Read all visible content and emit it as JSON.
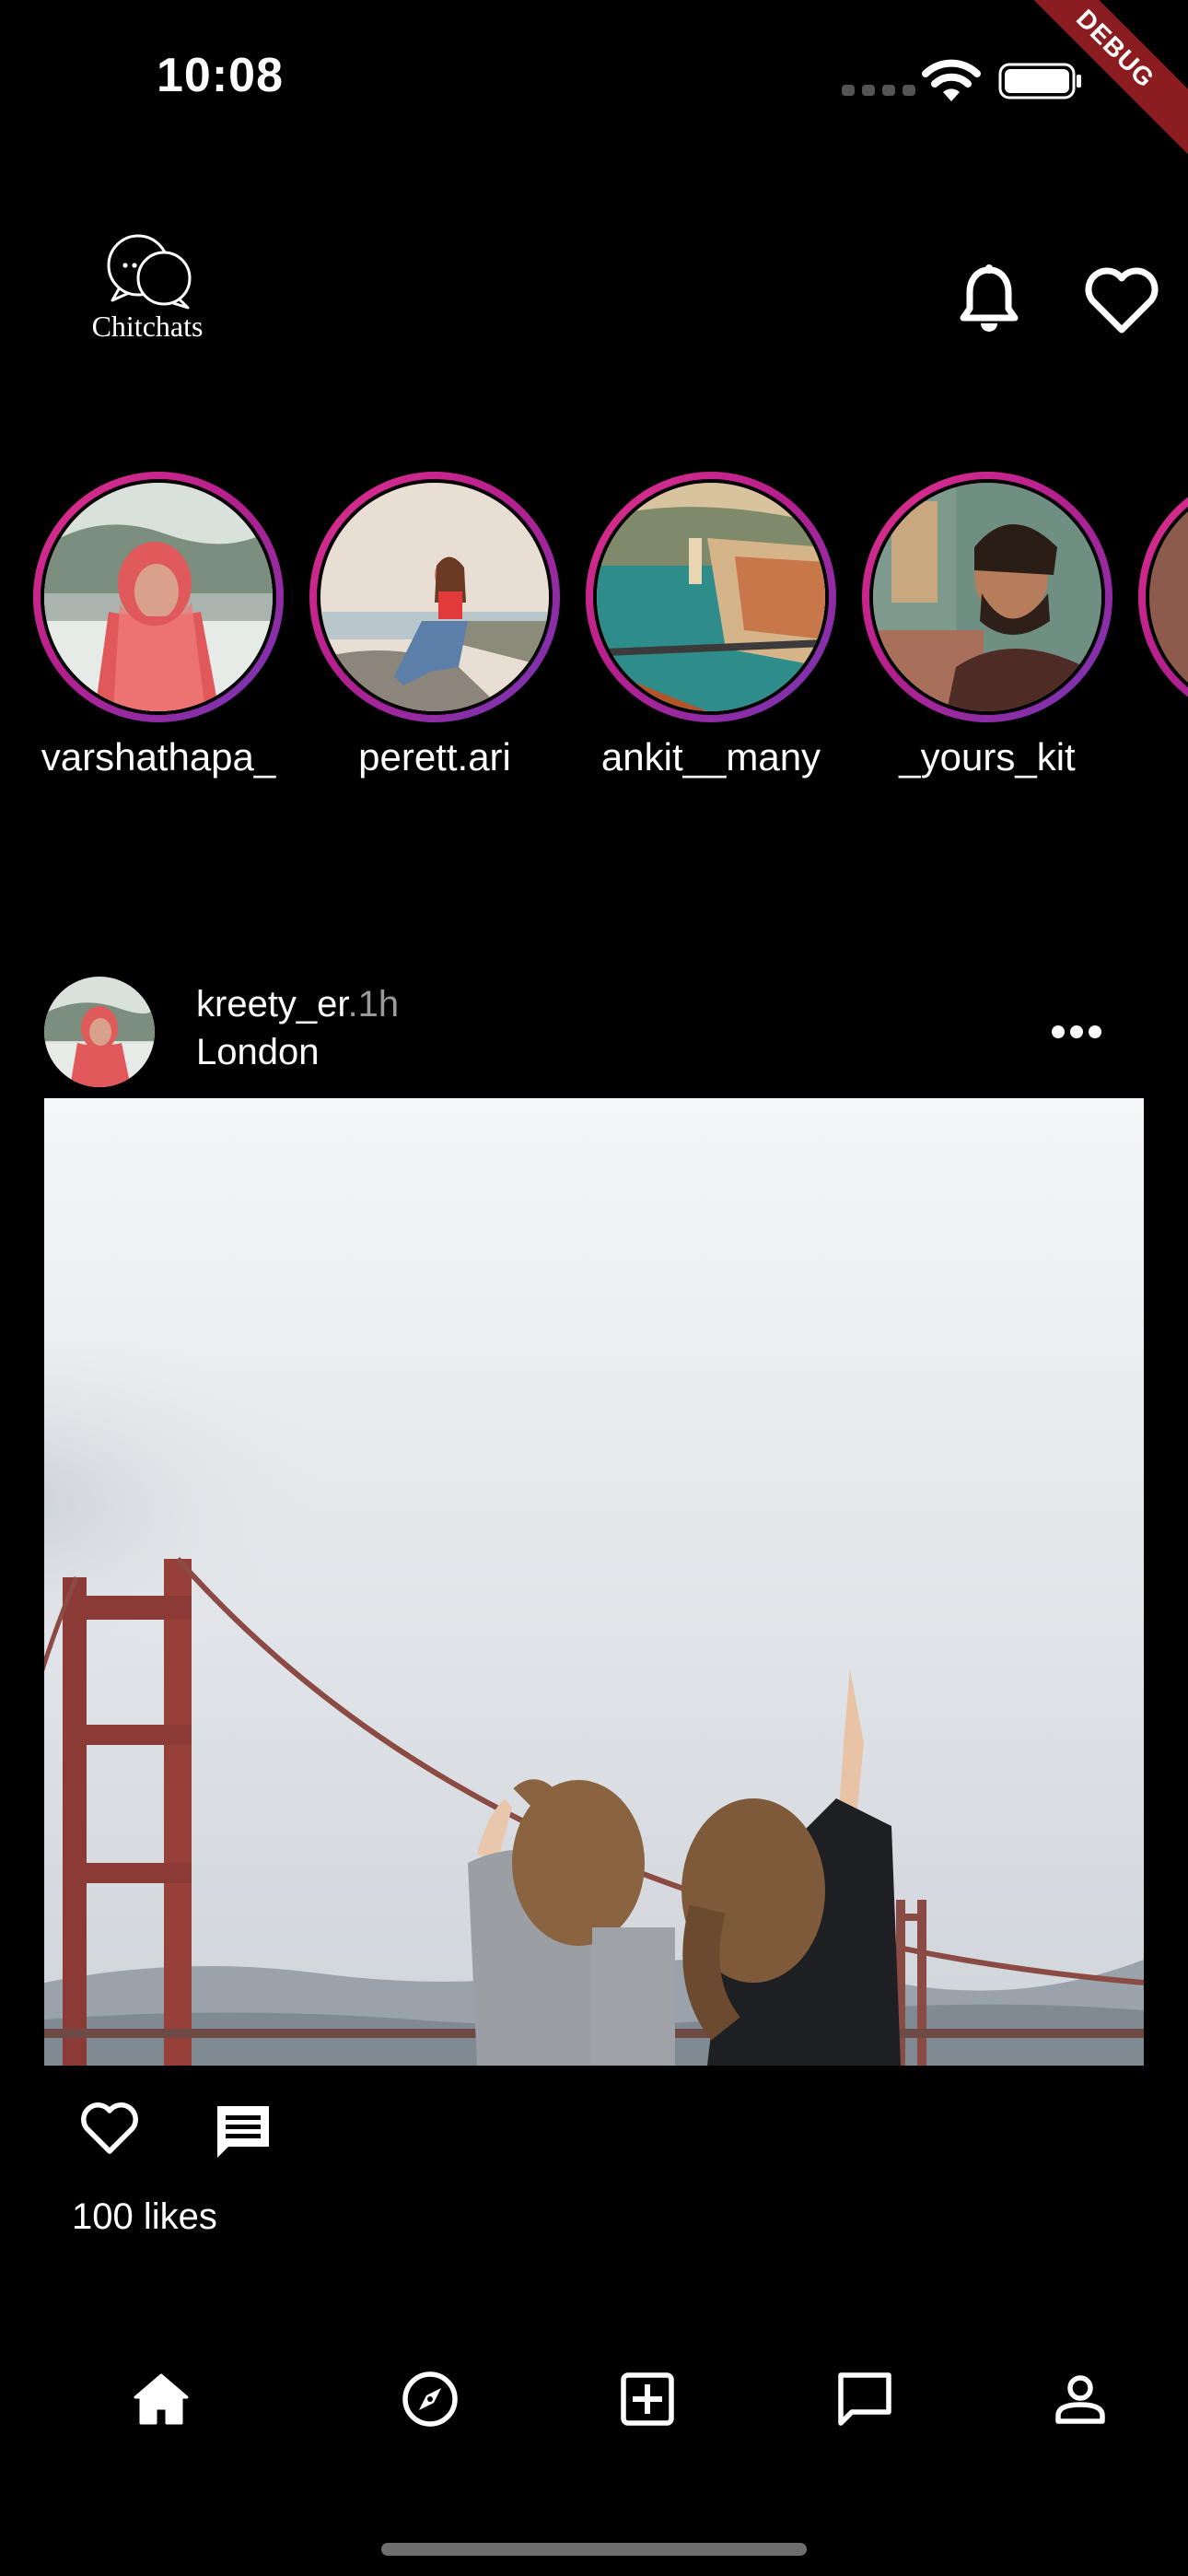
{
  "status_bar": {
    "time": "10:08",
    "debug_label": "DEBUG"
  },
  "header": {
    "logo_text": "Chitchats"
  },
  "stories": [
    {
      "username": "varshathapa_"
    },
    {
      "username": "perett.ari"
    },
    {
      "username": "ankit__many"
    },
    {
      "username": "_yours_kit"
    }
  ],
  "post": {
    "username": "kreety_er",
    "time": ".1h",
    "location": "London",
    "likes": "100 likes"
  },
  "colors": {
    "background": "#000000",
    "story_ring_start": "#e0308a",
    "story_ring_end": "#6f37b8",
    "muted_text": "#9a9a9a"
  },
  "icons": {
    "header": [
      "bell-icon",
      "heart-icon"
    ],
    "post_actions": [
      "heart-outline-icon",
      "comment-icon"
    ],
    "bottom_nav": [
      "home-icon",
      "compass-icon",
      "add-box-icon",
      "chat-bubble-icon",
      "person-icon"
    ]
  }
}
